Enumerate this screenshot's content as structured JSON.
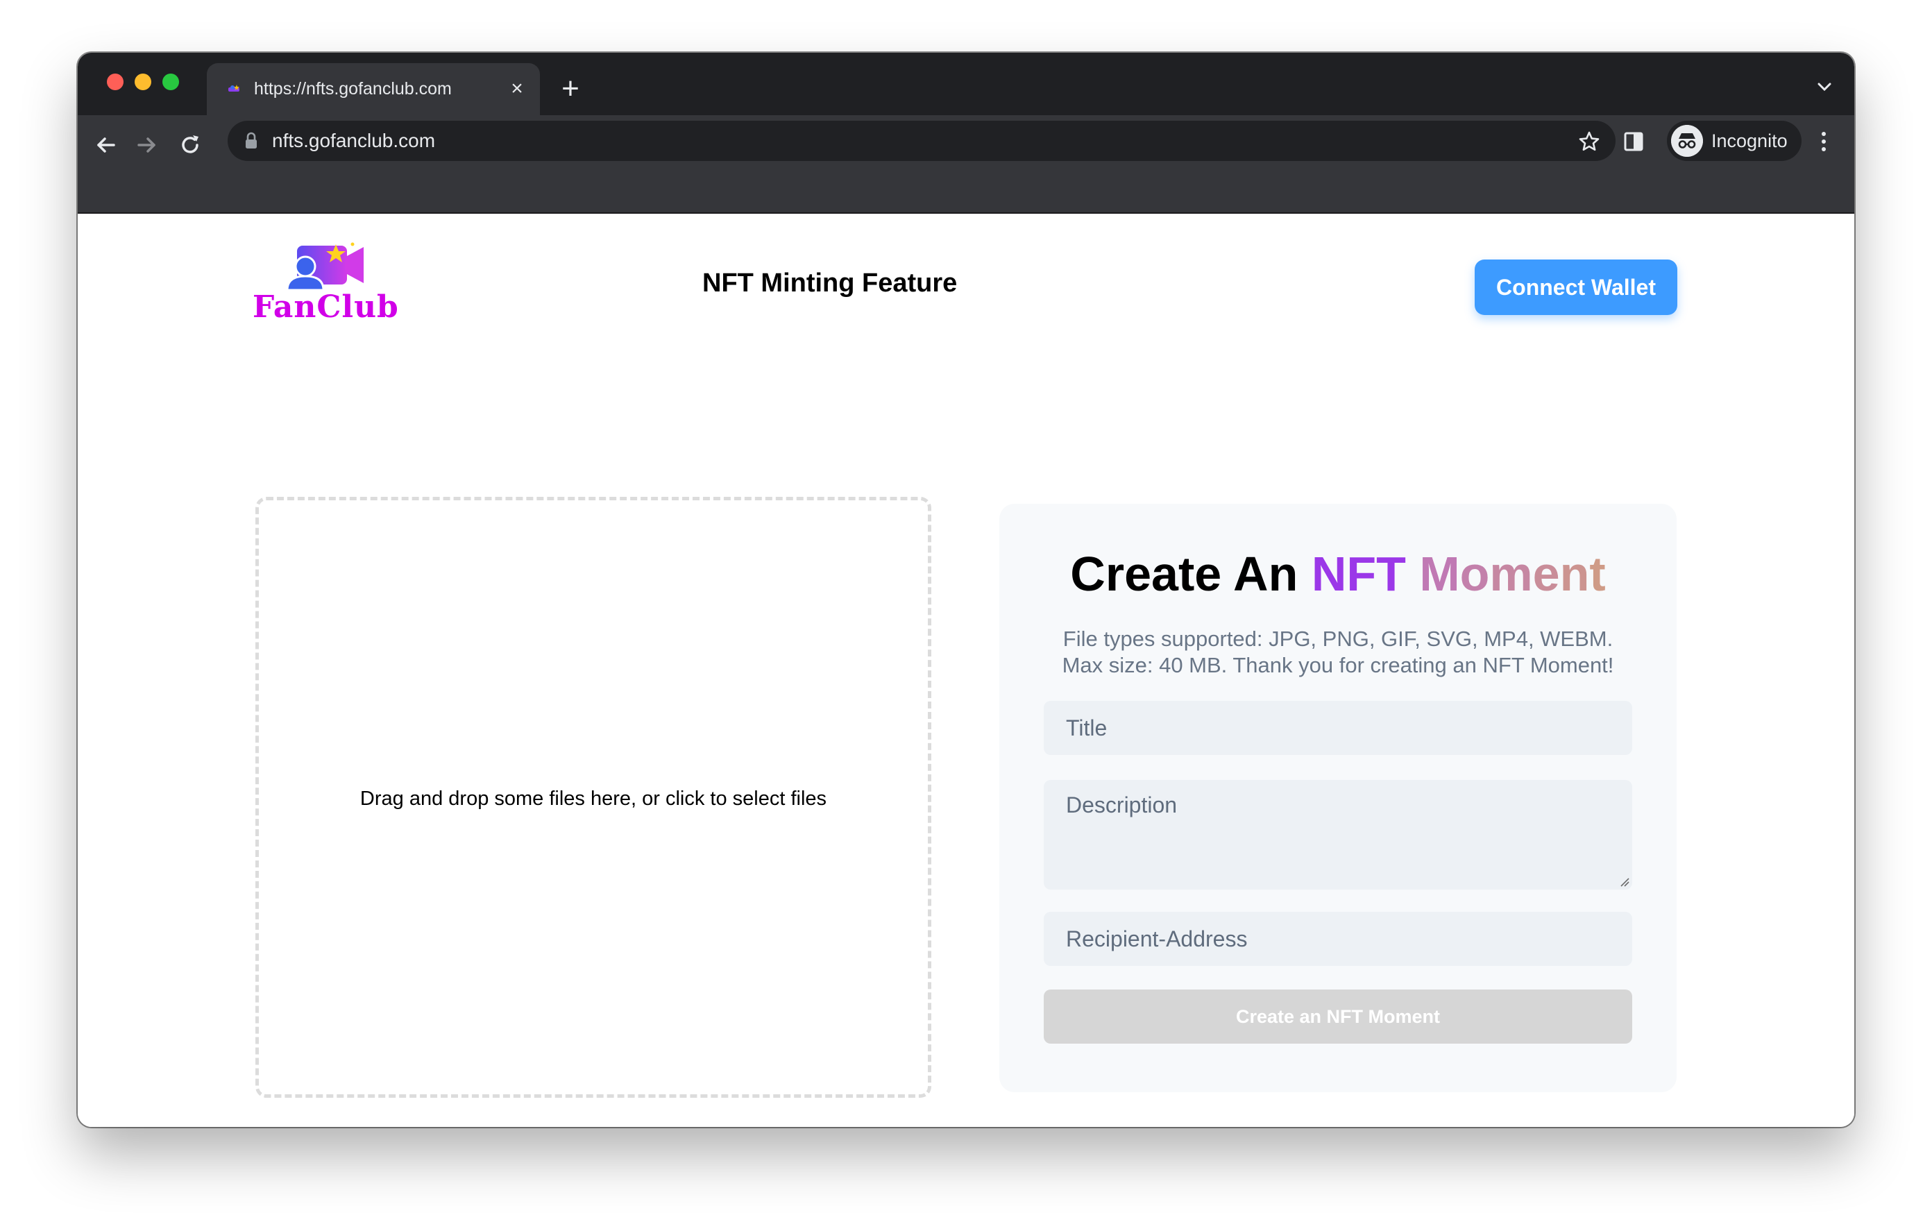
{
  "browser": {
    "tab_title": "https://nfts.gofanclub.com",
    "tab_close_icon": "close-icon",
    "new_tab_icon": "plus-icon",
    "address": "nfts.gofanclub.com",
    "profile_label": "Incognito"
  },
  "header": {
    "logo_text": "FanClub",
    "title": "NFT Minting Feature",
    "connect_label": "Connect Wallet"
  },
  "dropzone": {
    "text": "Drag and drop some files here, or click to select files"
  },
  "form": {
    "heading_plain": "Create An",
    "heading_accent_1": "NFT",
    "heading_accent_2": "Moment",
    "subtitle_line1": "File types supported: JPG, PNG, GIF, SVG, MP4, WEBM.",
    "subtitle_line2": "Max size: 40 MB. Thank you for creating an NFT Moment!",
    "title_placeholder": "Title",
    "description_placeholder": "Description",
    "recipient_placeholder": "Recipient-Address",
    "submit_label": "Create an NFT Moment"
  },
  "colors": {
    "accent_button": "#3d9bff",
    "logo_text": "#d100e8",
    "heading_gradient": [
      "#9b38e8",
      "#c079b4",
      "#cf9b87"
    ],
    "disabled_button": "#d6d6d6"
  }
}
